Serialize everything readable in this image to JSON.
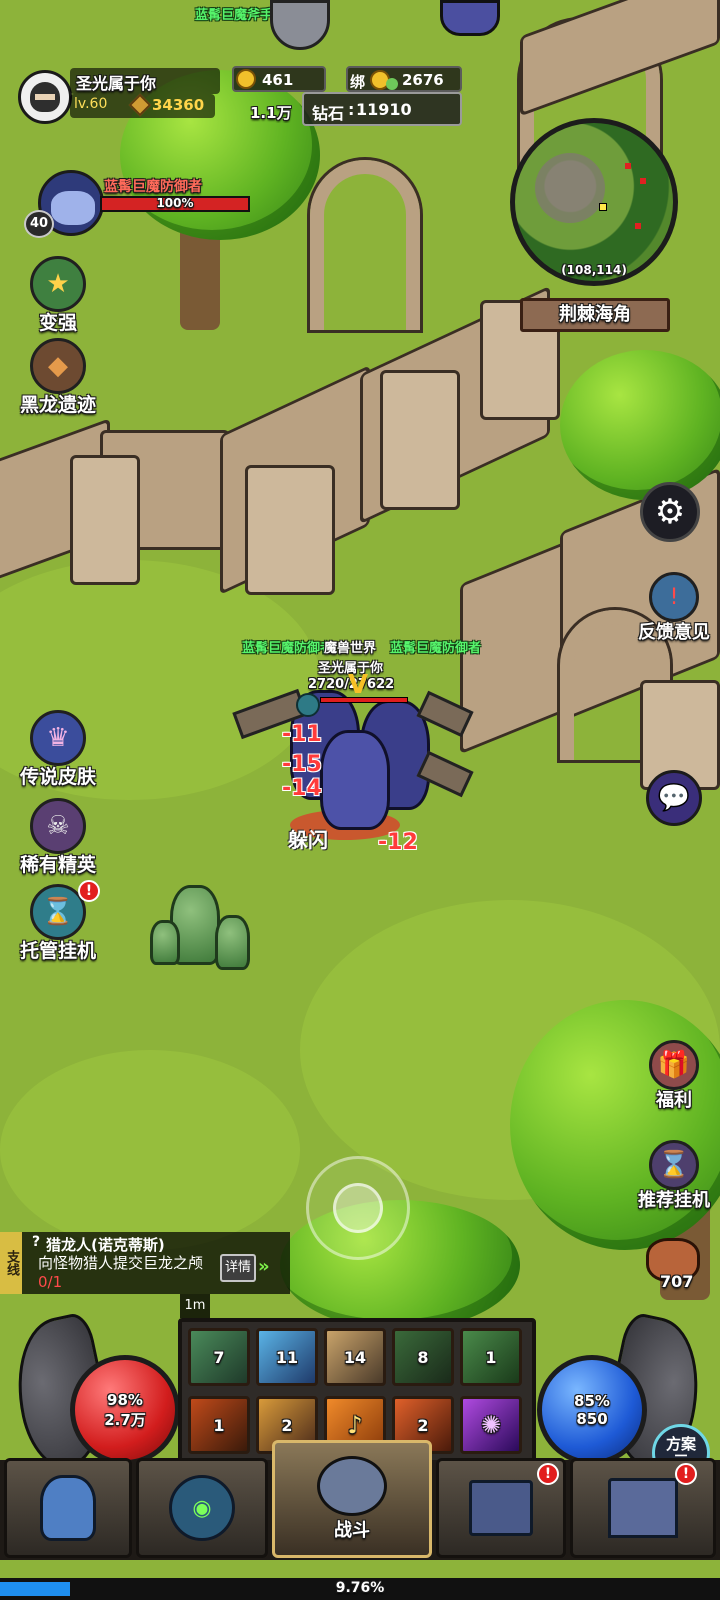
{
  "player": {
    "name": "圣光属于你",
    "level": "lv.60",
    "power": "34360",
    "gold": "461",
    "bound_label": "绑",
    "bound_gold": "2676",
    "diamond_label": "钻石",
    "diamond": "11910",
    "partial_value": "1.1万"
  },
  "target": {
    "name": "蓝髯巨魔防御者",
    "hp_percent": 100,
    "hp_label": "100%",
    "level": "40"
  },
  "top_enemy_name": "蓝髯巨魔斧手",
  "minimap": {
    "coords": "(108,114)",
    "location": "荆棘海角"
  },
  "left_menu": [
    {
      "label": "变强",
      "icon": "shield-upgrade-icon"
    },
    {
      "label": "黑龙遗迹",
      "icon": "dragon-icon"
    },
    {
      "label": "传说皮肤",
      "icon": "skin-icon"
    },
    {
      "label": "稀有精英",
      "icon": "elite-skull-icon"
    },
    {
      "label": "托管挂机",
      "icon": "auto-hang-icon"
    }
  ],
  "right_menu": {
    "settings_icon": "gear-icon",
    "feedback_label": "反馈意见",
    "chat_icon": "chat-icon",
    "welfare_label": "福利",
    "recommend_label": "推荐挂机",
    "meat_count": "707"
  },
  "battle": {
    "enemy_names": [
      "蓝髯巨魔防御者",
      "魔兽世界",
      "蓝髯巨魔防御者"
    ],
    "player_name": "圣光属于你",
    "player_hp": "2720/27622",
    "dodge_text": "躲闪",
    "damage_numbers": [
      "-11",
      "-15",
      "-14",
      "-12"
    ]
  },
  "quest": {
    "tag": "支线",
    "title": "猎龙人(诺克蒂斯)",
    "desc": "向怪物猎人提交巨龙之颅",
    "progress": "0/1",
    "detail_label": "详情",
    "timer": "1m"
  },
  "hp_orb": {
    "percent": "98%",
    "value": "2.7万"
  },
  "mp_orb": {
    "percent": "85%",
    "value": "850"
  },
  "plan_label": "方案三",
  "skills_row1": [
    "7",
    "11",
    "14",
    "8",
    "1"
  ],
  "skills_row2": [
    "1",
    "2",
    "",
    "2",
    ""
  ],
  "bottom_nav": {
    "battle_label": "战斗"
  },
  "exp": {
    "percent": 9.76,
    "label": "9.76%"
  }
}
